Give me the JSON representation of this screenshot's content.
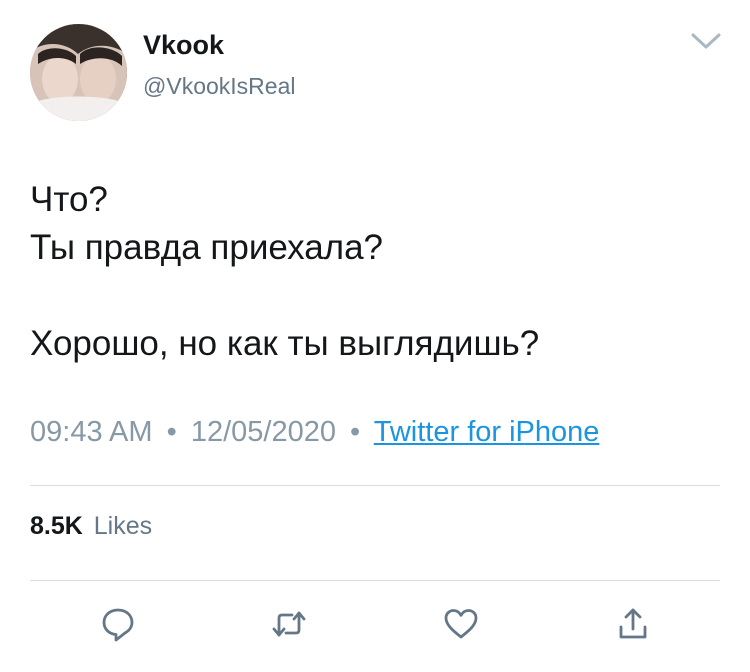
{
  "tweet": {
    "display_name": "Vkook",
    "handle": "@VkookIsReal",
    "avatar_icon": "profile-photo",
    "text_lines": [
      "Что?",
      "Ты правда приехала?",
      "",
      "Хорошо, но как ты выглядишь?"
    ],
    "time": "09:43 AM",
    "date": "12/05/2020",
    "separator": "•",
    "source": "Twitter for iPhone",
    "likes_count": "8.5K",
    "likes_label": "Likes"
  },
  "actions": [
    {
      "name": "reply",
      "icon": "reply-icon"
    },
    {
      "name": "retweet",
      "icon": "retweet-icon"
    },
    {
      "name": "like",
      "icon": "heart-icon"
    },
    {
      "name": "share",
      "icon": "share-icon"
    }
  ],
  "colors": {
    "text": "#14171a",
    "secondary": "#657786",
    "meta": "#8899a6",
    "link": "#1b95e0",
    "divider": "#d7dde2",
    "icon": "#657786"
  }
}
